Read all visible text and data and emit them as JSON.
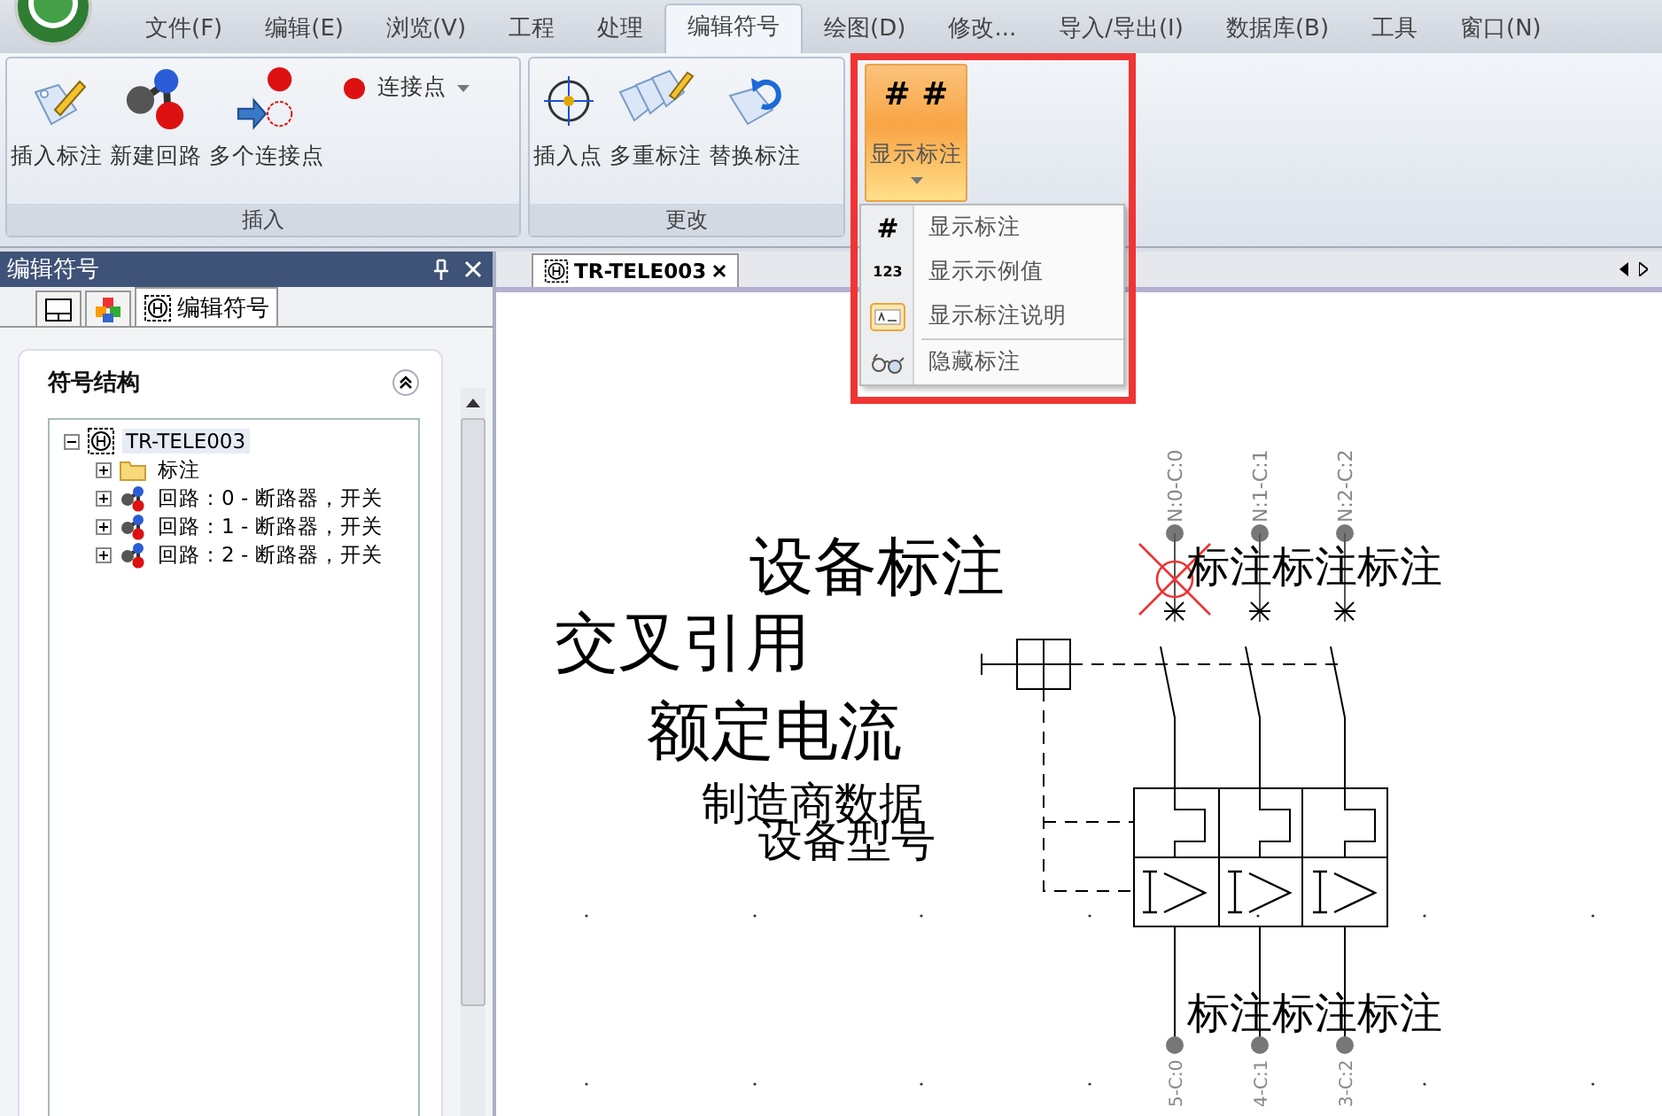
{
  "menu_tabs": [
    {
      "label": "文件(F)",
      "selected": false
    },
    {
      "label": "编辑(E)",
      "selected": false
    },
    {
      "label": "浏览(V)",
      "selected": false
    },
    {
      "label": "工程",
      "selected": false
    },
    {
      "label": "处理",
      "selected": false
    },
    {
      "label": "编辑符号",
      "selected": true
    },
    {
      "label": "绘图(D)",
      "selected": false
    },
    {
      "label": "修改...",
      "selected": false
    },
    {
      "label": "导入/导出(I)",
      "selected": false
    },
    {
      "label": "数据库(B)",
      "selected": false
    },
    {
      "label": "工具",
      "selected": false
    },
    {
      "label": "窗口(N)",
      "selected": false
    }
  ],
  "ribbon": {
    "insert_group": {
      "title": "插入",
      "buttons": [
        "插入标注",
        "新建回路",
        "多个连接点"
      ],
      "small_button": "连接点"
    },
    "change_group": {
      "title": "更改",
      "buttons": [
        "插入点",
        "多重标注",
        "替换标注"
      ]
    },
    "show_button": {
      "icon_text": "# #",
      "label": "显示标注",
      "pressed": true
    }
  },
  "dropdown_menu": [
    {
      "label": "显示标注",
      "kind": "hash",
      "icon_text": "#"
    },
    {
      "label": "显示示例值",
      "kind": "numbers",
      "icon_text": "123"
    },
    {
      "label": "显示标注说明",
      "kind": "box"
    },
    {
      "label": "隐藏标注",
      "kind": "glasses"
    }
  ],
  "panel": {
    "title": "编辑符号",
    "tabs": [
      {
        "kind": "page",
        "selected": false
      },
      {
        "kind": "cubes",
        "selected": false
      },
      {
        "kind": "symbol",
        "label": "编辑符号",
        "selected": true
      }
    ],
    "section_title": "符号结构",
    "tree": {
      "label": "TR-TELE003",
      "expanded": true,
      "selected": true,
      "children": [
        {
          "label": "标注",
          "kind": "folder",
          "expanded": false
        },
        {
          "label": "回路：0 - 断路器，开关",
          "kind": "circuit",
          "expanded": false
        },
        {
          "label": "回路：1 - 断路器，开关",
          "kind": "circuit",
          "expanded": false
        },
        {
          "label": "回路：2 - 断路器，开关",
          "kind": "circuit",
          "expanded": false
        }
      ]
    }
  },
  "document_tab": {
    "label": "TR-TELE003",
    "selected": true
  },
  "canvas": {
    "texts": [
      "设备标注",
      "交叉引用",
      "额定电流",
      "制造商数据",
      "设备型号"
    ],
    "top_terminals": [
      "N:0-C:0",
      "N:1-C:1",
      "N:2-C:2"
    ],
    "top_pole_labels": [
      "标注",
      "标注",
      "标注"
    ],
    "bottom_pole_labels": [
      "标注",
      "标注",
      "标注"
    ],
    "bottom_terminals": [
      "5-C:0",
      "4-C:1",
      "3-C:2"
    ]
  }
}
